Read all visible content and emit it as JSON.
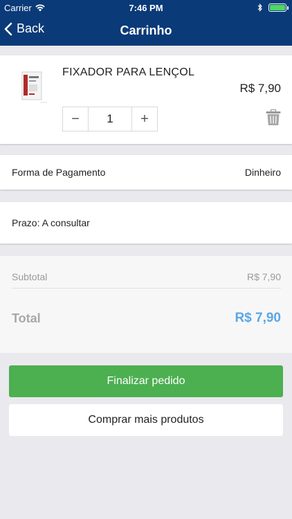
{
  "status_bar": {
    "carrier": "Carrier",
    "time": "7:46 PM",
    "icons": [
      "wifi-icon",
      "bluetooth-icon",
      "battery-icon"
    ]
  },
  "nav": {
    "back_label": "Back",
    "title": "Carrinho"
  },
  "cart": {
    "items": [
      {
        "name": "FIXADOR PARA LENÇOL",
        "price": "R$ 7,90",
        "quantity": "1",
        "decrement": "−",
        "increment": "+"
      }
    ]
  },
  "payment": {
    "label": "Forma de Pagamento",
    "value": "Dinheiro"
  },
  "prazo": {
    "label": "Prazo: A consultar"
  },
  "summary": {
    "subtotal_label": "Subtotal",
    "subtotal_value": "R$ 7,90",
    "total_label": "Total",
    "total_value": "R$ 7,90"
  },
  "actions": {
    "checkout": "Finalizar pedido",
    "continue": "Comprar mais produtos"
  },
  "colors": {
    "nav_bg": "#0a3a78",
    "primary_button": "#4caf50",
    "total_accent": "#5aa6e6"
  }
}
